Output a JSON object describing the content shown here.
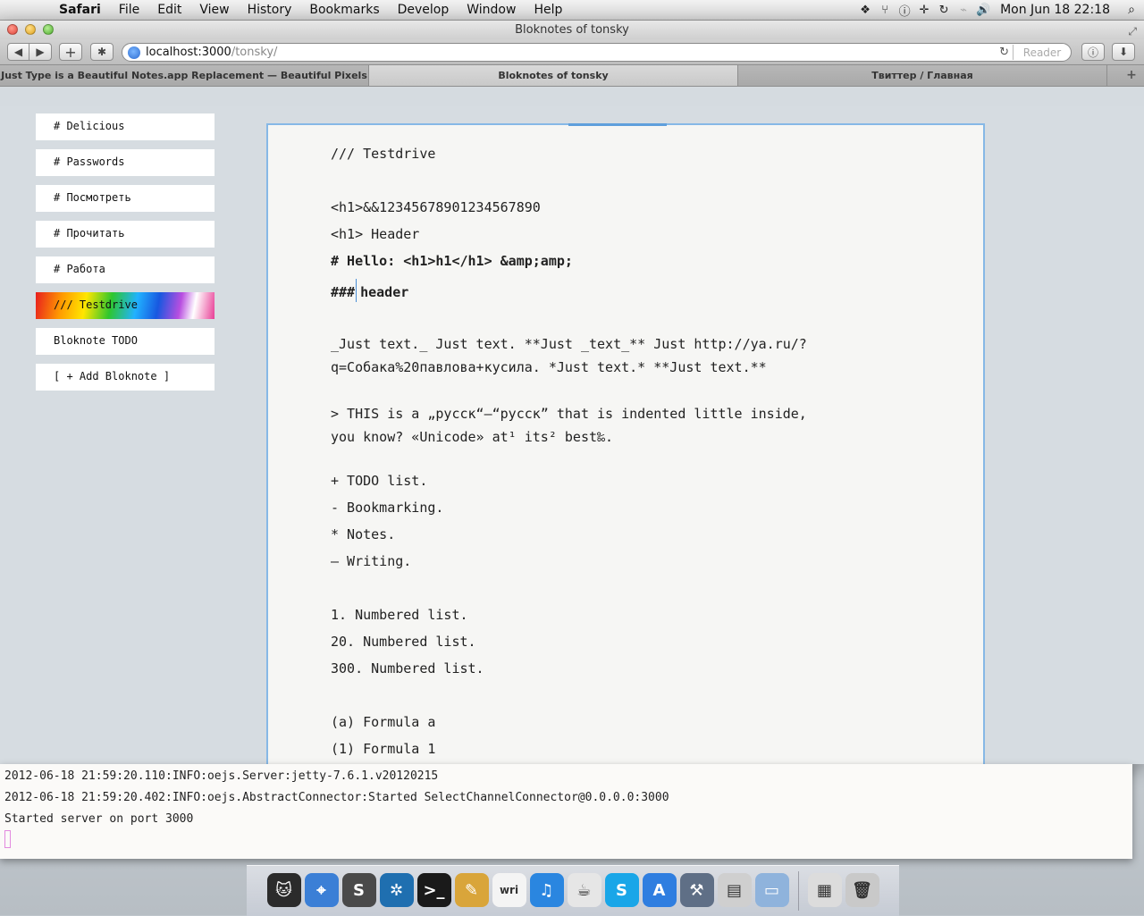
{
  "menubar": {
    "apple_glyph": "",
    "items": [
      "Safari",
      "File",
      "Edit",
      "View",
      "History",
      "Bookmarks",
      "Develop",
      "Window",
      "Help"
    ],
    "status_icons": [
      "dropbox-icon",
      "network-icon",
      "info-icon",
      "move-icon",
      "sync-icon",
      "wifi-icon",
      "volume-icon"
    ],
    "clock": "Mon Jun 18  22:18"
  },
  "window": {
    "title": "Bloknotes of tonsky",
    "address_host": "localhost:3000",
    "address_path": "/tonsky/",
    "reader_label": "Reader",
    "tabs": [
      "Just Type is a Beautiful Notes.app Replacement — Beautiful Pixels",
      "Bloknotes of tonsky",
      "Твиттер / Главная"
    ]
  },
  "sidebar": {
    "items": [
      "# Delicious",
      "# Passwords",
      "# Посмотреть",
      "# Прочитать",
      "# Работа",
      "/// Testdrive",
      "Bloknote TODO",
      "[ + Add Bloknote ]"
    ]
  },
  "editor": {
    "lines": [
      "/// Testdrive",
      "",
      "<h1>&&12345678901234567890",
      "<h1> Header",
      "# Hello: <h1>h1</h1> &amp;amp;",
      "###",
      "header",
      "",
      "_Just text._ Just text. **Just _text_** Just http://ya.ru/?q=Собака%20павлова+кусила. *Just text.* **Just text.**",
      "",
      "> THIS is a „русск“—“русск” that is indented little inside, you know? «Unicode» at¹ its² best‰.",
      "",
      "+ TODO list.",
      "- Bookmarking.",
      "* Notes.",
      "— Writing.",
      "",
      "1. Numbered list.",
      "20. Numbered list.",
      "300. Numbered list.",
      "",
      "(a) Formula a",
      "(1) Formula 1"
    ]
  },
  "terminal": {
    "lines": [
      "2012-06-18 21:59:20.110:INFO:oejs.Server:jetty-7.6.1.v20120215",
      "2012-06-18 21:59:20.402:INFO:oejs.AbstractConnector:Started SelectChannelConnector@0.0.0.0:3000",
      "Started server on port 3000"
    ]
  },
  "dock": {
    "icons": [
      {
        "name": "finder-cat-icon",
        "glyph": "🐱",
        "color": "#2b2b2b"
      },
      {
        "name": "safari-icon",
        "glyph": "⌖",
        "color": "#3b7fd6"
      },
      {
        "name": "sublime-icon",
        "glyph": "S",
        "color": "#4a4a4a"
      },
      {
        "name": "sourcetree-icon",
        "glyph": "✲",
        "color": "#1f6fb0"
      },
      {
        "name": "terminal-icon",
        "glyph": ">_",
        "color": "#1a1a1a"
      },
      {
        "name": "textedit-icon",
        "glyph": "✎",
        "color": "#d9a53a"
      },
      {
        "name": "writer-icon",
        "glyph": "wri",
        "color": "#f4f4f4"
      },
      {
        "name": "itunes-icon",
        "glyph": "♫",
        "color": "#2a86e0"
      },
      {
        "name": "coffee-icon",
        "glyph": "☕",
        "color": "#e6e6e6"
      },
      {
        "name": "skype-icon",
        "glyph": "S",
        "color": "#19a6e8"
      },
      {
        "name": "appstore-icon",
        "glyph": "A",
        "color": "#2f7ee0"
      },
      {
        "name": "xcode-icon",
        "glyph": "⚒",
        "color": "#5f6f86"
      },
      {
        "name": "preview-icon",
        "glyph": "▤",
        "color": "#cfcfcf"
      },
      {
        "name": "folder-icon",
        "glyph": "▭",
        "color": "#8fb3dc"
      },
      {
        "name": "documents-icon",
        "glyph": "▦",
        "color": "#dcdcdc"
      },
      {
        "name": "trash-icon",
        "glyph": "🗑",
        "color": "#c9c9c9"
      }
    ]
  }
}
